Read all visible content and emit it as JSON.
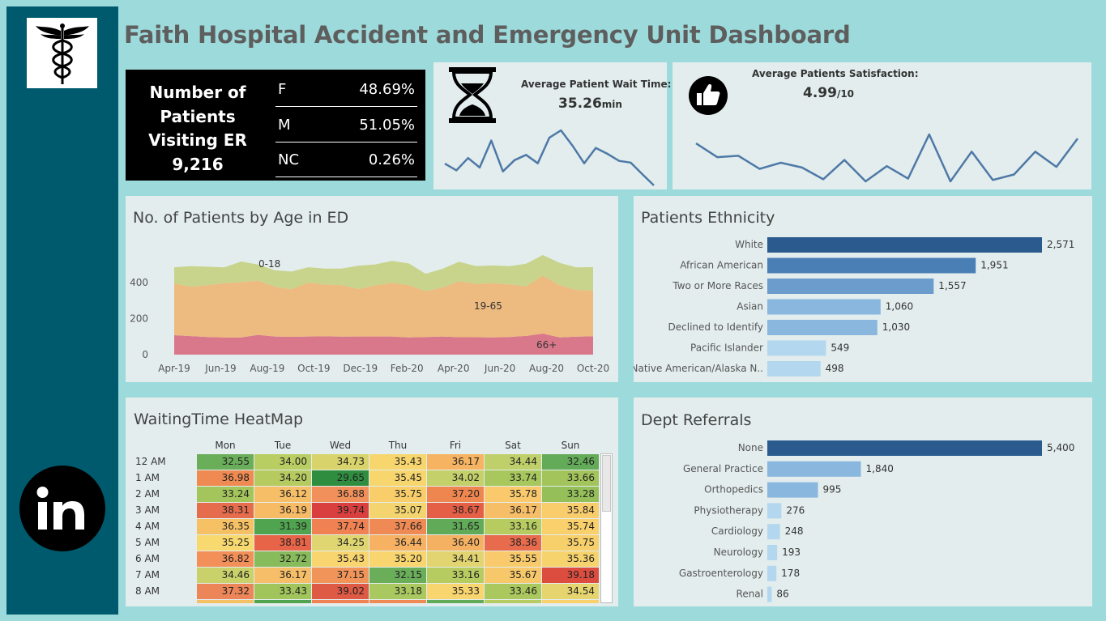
{
  "header": {
    "title": "Faith Hospital Accident and Emergency Unit Dashboard"
  },
  "icons": {
    "logo": "caduceus-icon",
    "linkedin": "linkedin-icon",
    "wait": "hourglass-icon",
    "satisfaction": "thumbs-up-icon"
  },
  "patients_card": {
    "label_line1": "Number of",
    "label_line2": "Patients",
    "label_line3": "Visiting ER",
    "total": "9,216",
    "genders": [
      {
        "code": "F",
        "pct": "48.69%"
      },
      {
        "code": "M",
        "pct": "51.05%"
      },
      {
        "code": "NC",
        "pct": "0.26%"
      }
    ]
  },
  "wait_card": {
    "label": "Average Patient Wait Time:",
    "value": "35.26",
    "unit": "min",
    "trend": [
      62,
      43,
      78,
      51,
      128,
      40,
      72,
      87,
      63,
      136,
      157,
      113,
      63,
      107,
      90,
      70,
      65,
      32,
      0
    ]
  },
  "satisfaction_card": {
    "label": "Average Patients Satisfaction:",
    "value": "4.99",
    "unit": "/10",
    "trend": [
      55,
      35,
      37,
      18,
      27,
      20,
      3,
      31,
      0,
      22,
      4,
      68,
      0,
      43,
      2,
      10,
      43,
      21,
      62
    ]
  },
  "age_chart": {
    "title": "No. of Patients by Age in ED",
    "chart_data": {
      "type": "area",
      "x": [
        "Apr-19",
        "Jun-19",
        "Aug-19",
        "Oct-19",
        "Dec-19",
        "Feb-20",
        "Apr-20",
        "Jun-20",
        "Aug-20",
        "Oct-20"
      ],
      "xticks": [
        "Apr-19",
        "Jun-19",
        "Aug-19",
        "Oct-19",
        "Dec-19",
        "Feb-20",
        "Apr-20",
        "Jun-20",
        "Aug-20",
        "Oct-20"
      ],
      "yticks": [
        "0",
        "200",
        "400"
      ],
      "ylim": [
        0,
        560
      ],
      "series": [
        {
          "name": "66+",
          "color": "#d9788a",
          "values": [
            108,
            103,
            98,
            96,
            96,
            110,
            101,
            99,
            101,
            102,
            100,
            101,
            101,
            101,
            96,
            98,
            101,
            97,
            97,
            96,
            98,
            104,
            117,
            96,
            100,
            102
          ]
        },
        {
          "name": "19-65",
          "color": "#edba80",
          "values": [
            288,
            275,
            288,
            301,
            307,
            302,
            277,
            265,
            300,
            288,
            286,
            264,
            284,
            298,
            291,
            255,
            272,
            311,
            297,
            301,
            293,
            276,
            322,
            290,
            260,
            254
          ]
        },
        {
          "name": "0-18",
          "color": "#c8d38c",
          "values": [
            90,
            114,
            103,
            88,
            115,
            89,
            92,
            98,
            85,
            89,
            93,
            130,
            117,
            122,
            120,
            97,
            104,
            109,
            99,
            99,
            101,
            126,
            115,
            125,
            125,
            131
          ]
        }
      ],
      "area_labels": {
        "a": "0-18",
        "b": "19-65",
        "c": "66+"
      }
    }
  },
  "ethnicity_chart": {
    "title": "Patients Ethnicity",
    "chart_data": {
      "type": "bar",
      "categories": [
        "White",
        "African American",
        "Two or More Races",
        "Asian",
        "Declined to Identify",
        "Pacific Islander",
        "Native American/Alaska N.."
      ],
      "values": [
        2571,
        1951,
        1557,
        1060,
        1030,
        549,
        498
      ],
      "labels": [
        "2,571",
        "1,951",
        "1,557",
        "1,060",
        "1,030",
        "549",
        "498"
      ],
      "colors": [
        "#2b5b8e",
        "#4a7fb5",
        "#6b9ccc",
        "#8ab7de",
        "#8ab7de",
        "#b3d7ee",
        "#b3d7ee"
      ]
    }
  },
  "referral_chart": {
    "title": "Dept Referrals",
    "chart_data": {
      "type": "bar",
      "categories": [
        "None",
        "General Practice",
        "Orthopedics",
        "Physiotherapy",
        "Cardiology",
        "Neurology",
        "Gastroenterology",
        "Renal"
      ],
      "values": [
        5400,
        1840,
        995,
        276,
        248,
        193,
        178,
        86
      ],
      "labels": [
        "5,400",
        "1,840",
        "995",
        "276",
        "248",
        "193",
        "178",
        "86"
      ],
      "colors": [
        "#2b5b8e",
        "#8ab7de",
        "#8ab7de",
        "#b3d7ee",
        "#b3d7ee",
        "#b3d7ee",
        "#b3d7ee",
        "#b3d7ee"
      ]
    }
  },
  "heatmap": {
    "title": "WaitingTime HeatMap",
    "days": [
      "Mon",
      "Tue",
      "Wed",
      "Thu",
      "Fri",
      "Sat",
      "Sun"
    ],
    "hours": [
      "12 AM",
      "1 AM",
      "2 AM",
      "3 AM",
      "4 AM",
      "5 AM",
      "6 AM",
      "7 AM",
      "8 AM"
    ],
    "values": [
      [
        "32.55",
        "34.00",
        "34.73",
        "35.43",
        "36.17",
        "34.44",
        "32.46"
      ],
      [
        "36.98",
        "34.20",
        "29.65",
        "35.45",
        "34.02",
        "33.74",
        "33.66"
      ],
      [
        "33.24",
        "36.12",
        "36.88",
        "35.75",
        "37.20",
        "35.78",
        "33.28"
      ],
      [
        "38.31",
        "36.19",
        "39.74",
        "35.07",
        "38.67",
        "36.17",
        "35.84"
      ],
      [
        "36.35",
        "31.39",
        "37.74",
        "37.66",
        "31.65",
        "33.16",
        "35.74"
      ],
      [
        "35.25",
        "38.81",
        "34.25",
        "36.44",
        "36.40",
        "38.36",
        "35.75"
      ],
      [
        "36.82",
        "32.72",
        "35.43",
        "35.20",
        "34.41",
        "35.55",
        "35.36"
      ],
      [
        "34.46",
        "36.17",
        "37.15",
        "32.15",
        "33.16",
        "35.67",
        "39.18"
      ],
      [
        "37.32",
        "33.43",
        "39.02",
        "33.18",
        "35.33",
        "33.46",
        "34.54"
      ]
    ],
    "colors": [
      [
        "#6aae5a",
        "#b8cd62",
        "#d8d36a",
        "#f8d66e",
        "#f6b463",
        "#bfd06a",
        "#63ab58"
      ],
      [
        "#ef8a52",
        "#b5cb5f",
        "#2f8d3f",
        "#f8d66e",
        "#c4d06a",
        "#a8c75c",
        "#a2c45b"
      ],
      [
        "#a4c55b",
        "#f7be68",
        "#f1905a",
        "#f9ce6a",
        "#ef8650",
        "#f9c96c",
        "#94bf59"
      ],
      [
        "#e56c4c",
        "#f7bb66",
        "#d93f3f",
        "#f3d46e",
        "#e55f46",
        "#f7be68",
        "#f9cd6c"
      ],
      [
        "#f5c164",
        "#51a44f",
        "#ef8153",
        "#f08a55",
        "#61aa58",
        "#b6cc61",
        "#f9d06c"
      ],
      [
        "#f8d96f",
        "#e76448",
        "#dfd571",
        "#f6b163",
        "#f5b162",
        "#e86b4d",
        "#f8d06b"
      ],
      [
        "#f3905a",
        "#88bb5b",
        "#f9d56f",
        "#f9d56f",
        "#e2d470",
        "#f9ca6b",
        "#f7d36d"
      ],
      [
        "#c9d16a",
        "#f6be68",
        "#f0945a",
        "#6aae5a",
        "#b6cc61",
        "#f7c869",
        "#dc4d40"
      ],
      [
        "#ec8557",
        "#a1c45b",
        "#df5a45",
        "#a9c85f",
        "#f9d56f",
        "#aac85d",
        "#e6d56e"
      ]
    ]
  }
}
